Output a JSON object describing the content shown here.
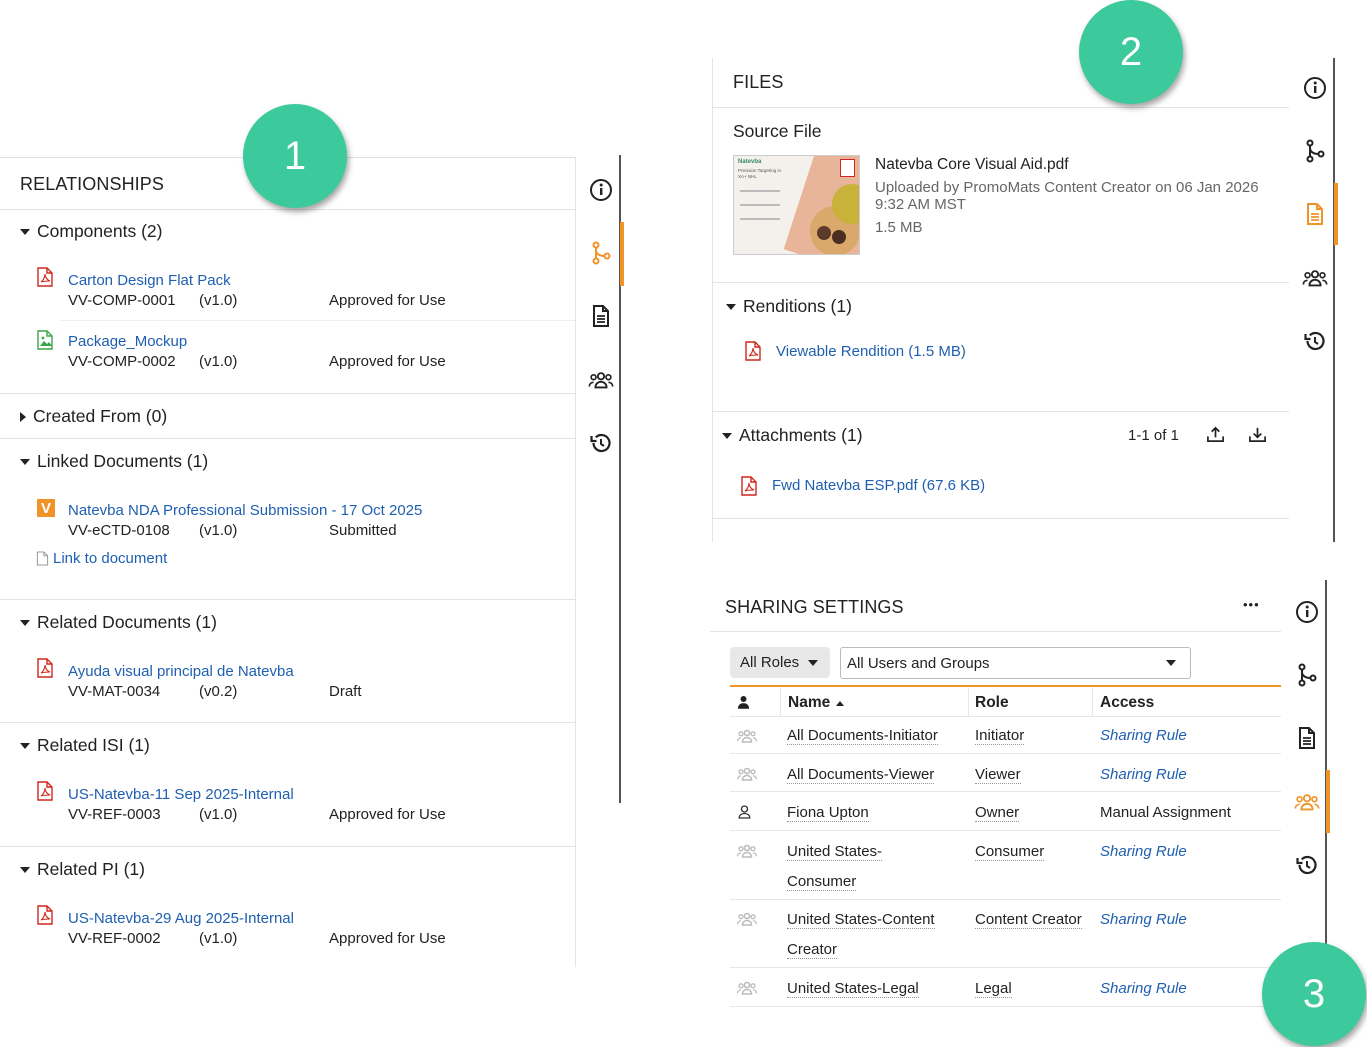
{
  "badges": [
    "1",
    "2",
    "3"
  ],
  "relationships": {
    "title": "RELATIONSHIPS",
    "sections": {
      "components": {
        "label": "Components (2)",
        "items": [
          {
            "title": "Carton Design Flat Pack",
            "id": "VV-COMP-0001",
            "version": "(v1.0)",
            "status": "Approved for Use",
            "icon": "pdf-icon"
          },
          {
            "title": "Package_Mockup",
            "id": "VV-COMP-0002",
            "version": "(v1.0)",
            "status": "Approved for Use",
            "icon": "image-file-icon"
          }
        ]
      },
      "created_from": {
        "label": "Created From (0)"
      },
      "linked": {
        "label": "Linked Documents (1)",
        "items": [
          {
            "title": "Natevba NDA Professional Submission - 17 Oct 2025",
            "id": "VV-eCTD-0108",
            "version": "(v1.0)",
            "status": "Submitted",
            "icon": "vault-v-icon"
          }
        ],
        "link_label": "Link to document"
      },
      "related_docs": {
        "label": "Related Documents (1)",
        "items": [
          {
            "title": "Ayuda visual principal de Natevba",
            "id": "VV-MAT-0034",
            "version": "(v0.2)",
            "status": "Draft",
            "icon": "pdf-icon"
          }
        ]
      },
      "related_isi": {
        "label": "Related ISI (1)",
        "items": [
          {
            "title": "US-Natevba-11 Sep 2025-Internal",
            "id": "VV-REF-0003",
            "version": "(v1.0)",
            "status": "Approved for Use",
            "icon": "pdf-icon"
          }
        ]
      },
      "related_pi": {
        "label": "Related PI (1)",
        "items": [
          {
            "title": "US-Natevba-29 Aug 2025-Internal",
            "id": "VV-REF-0002",
            "version": "(v1.0)",
            "status": "Approved for Use",
            "icon": "pdf-icon"
          }
        ]
      }
    }
  },
  "files": {
    "title": "FILES",
    "source_label": "Source File",
    "file_name": "Natevba Core Visual Aid.pdf",
    "uploaded_line1": "Uploaded by PromoMats Content Creator on 06 Jan 2026",
    "uploaded_line2": "9:32 AM MST",
    "size": "1.5 MB",
    "thumb_brand": "Natevba",
    "thumb_tagline": "Precision Targeting in XA+ NHL",
    "renditions_label": "Renditions (1)",
    "rendition_link": "Viewable Rendition (1.5 MB)",
    "attachments_label": "Attachments (1)",
    "attachments_count": "1-1 of 1",
    "attachment_link": "Fwd Natevba ESP.pdf (67.6 KB)"
  },
  "sharing": {
    "title": "SHARING SETTINGS",
    "more": "•••",
    "roles_filter": "All Roles",
    "users_filter": "All Users and Groups",
    "headers": {
      "name": "Name",
      "role": "Role",
      "access": "Access"
    },
    "rows": [
      {
        "name": "All Documents-Initiator",
        "role": "Initiator",
        "access": "Sharing Rule",
        "type": "group"
      },
      {
        "name": "All Documents-Viewer",
        "role": "Viewer",
        "access": "Sharing Rule",
        "type": "group"
      },
      {
        "name": "Fiona Upton",
        "role": "Owner",
        "access": "Manual Assignment",
        "type": "user"
      },
      {
        "name": "United States-Consumer",
        "name_l1": "United States-",
        "name_l2": "Consumer",
        "role": "Consumer",
        "access": "Sharing Rule",
        "type": "group"
      },
      {
        "name": "United States-Content Creator",
        "name_l1": "United States-Content",
        "name_l2": "Creator",
        "role": "Content Creator",
        "access": "Sharing Rule",
        "type": "group"
      },
      {
        "name": "United States-Legal",
        "role": "Legal",
        "access": "Sharing Rule",
        "type": "group"
      }
    ]
  },
  "colors": {
    "accent": "#f0942a",
    "link": "#1f5fb0",
    "badge": "#3cc99c",
    "pdf": "#d0271d"
  }
}
